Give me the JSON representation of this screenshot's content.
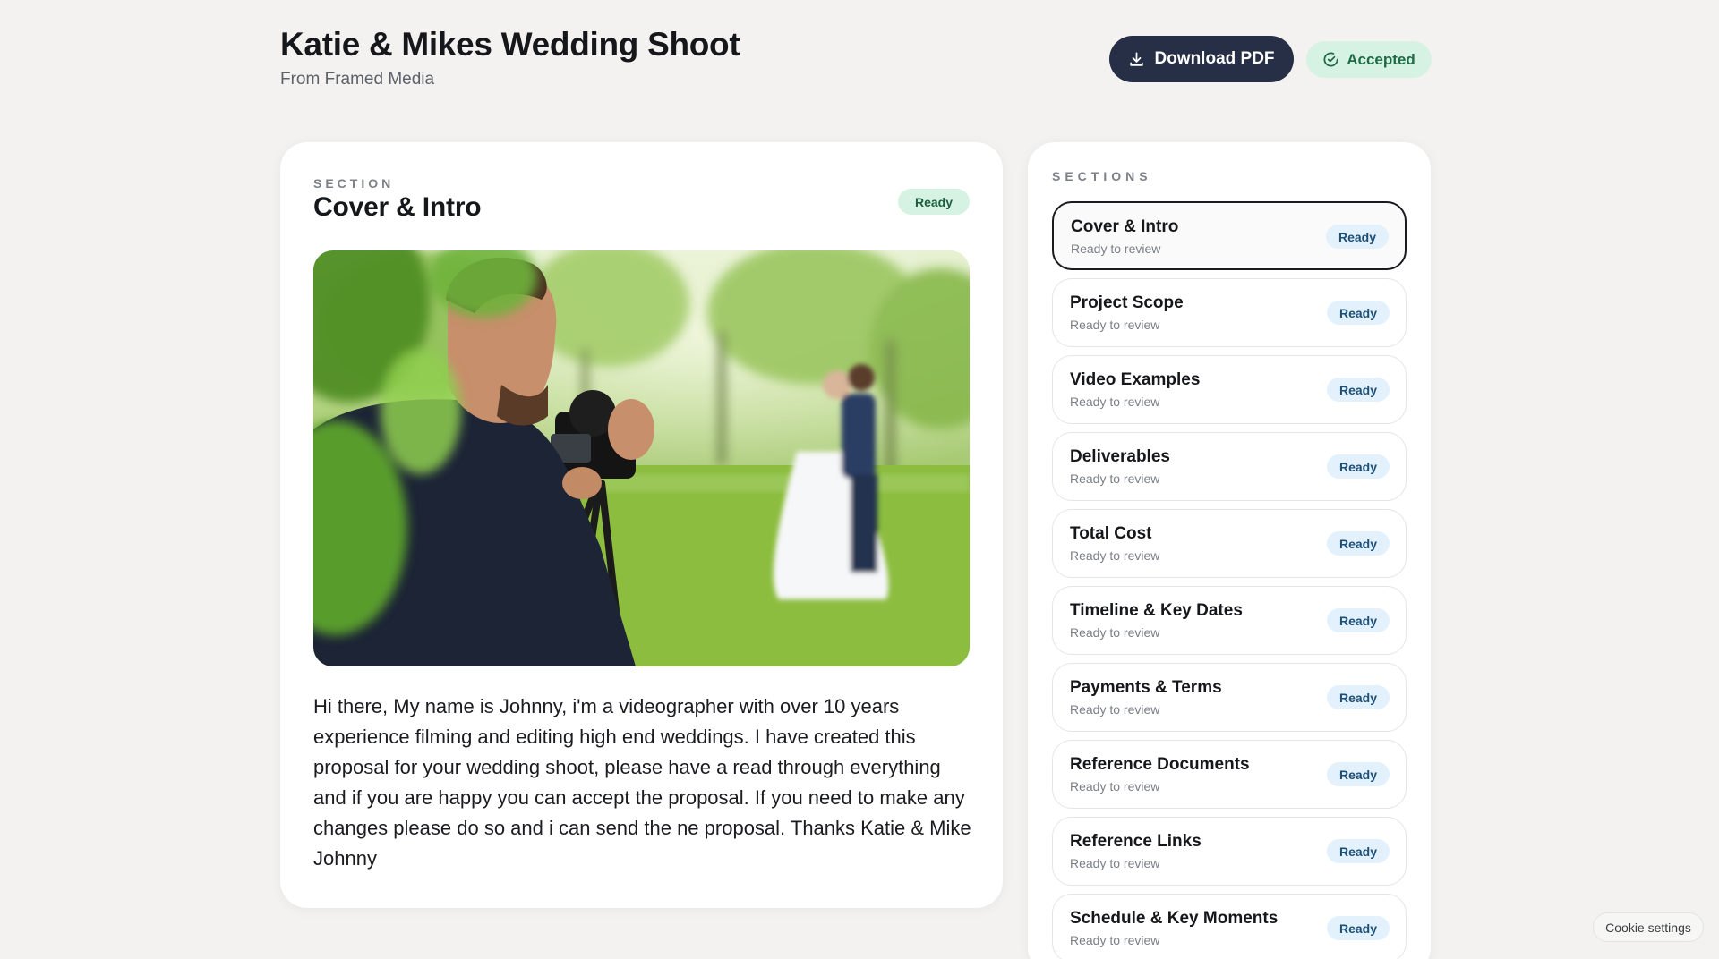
{
  "header": {
    "title": "Katie & Mikes Wedding Shoot",
    "subtitle": "From Framed Media",
    "download_label": "Download PDF",
    "status_label": "Accepted"
  },
  "main": {
    "section_label": "SECTION",
    "section_title": "Cover & Intro",
    "status": "Ready",
    "intro_text": "Hi there, My name is Johnny, i'm a videographer with over 10 years experience filming and editing high end weddings. I have created this proposal for your wedding shoot, please have a read through everything and if you are happy you can accept the proposal. If you need to make any changes please do so and i can send the ne proposal. Thanks Katie & Mike Johnny"
  },
  "sidebar": {
    "label": "SECTIONS",
    "items": [
      {
        "title": "Cover & Intro",
        "subtitle": "Ready to review",
        "status": "Ready"
      },
      {
        "title": "Project Scope",
        "subtitle": "Ready to review",
        "status": "Ready"
      },
      {
        "title": "Video Examples",
        "subtitle": "Ready to review",
        "status": "Ready"
      },
      {
        "title": "Deliverables",
        "subtitle": "Ready to review",
        "status": "Ready"
      },
      {
        "title": "Total Cost",
        "subtitle": "Ready to review",
        "status": "Ready"
      },
      {
        "title": "Timeline & Key Dates",
        "subtitle": "Ready to review",
        "status": "Ready"
      },
      {
        "title": "Payments & Terms",
        "subtitle": "Ready to review",
        "status": "Ready"
      },
      {
        "title": "Reference Documents",
        "subtitle": "Ready to review",
        "status": "Ready"
      },
      {
        "title": "Reference Links",
        "subtitle": "Ready to review",
        "status": "Ready"
      },
      {
        "title": "Schedule & Key Moments",
        "subtitle": "Ready to review",
        "status": "Ready"
      }
    ]
  },
  "cookie_label": "Cookie settings",
  "colors": {
    "background": "#f3f2f0",
    "primary_button": "#262f45",
    "accepted_bg": "#d6f2e2",
    "ready_blue_bg": "#e2f1fb"
  },
  "icons": {
    "download": "download-icon",
    "accepted": "check-circle-icon"
  }
}
